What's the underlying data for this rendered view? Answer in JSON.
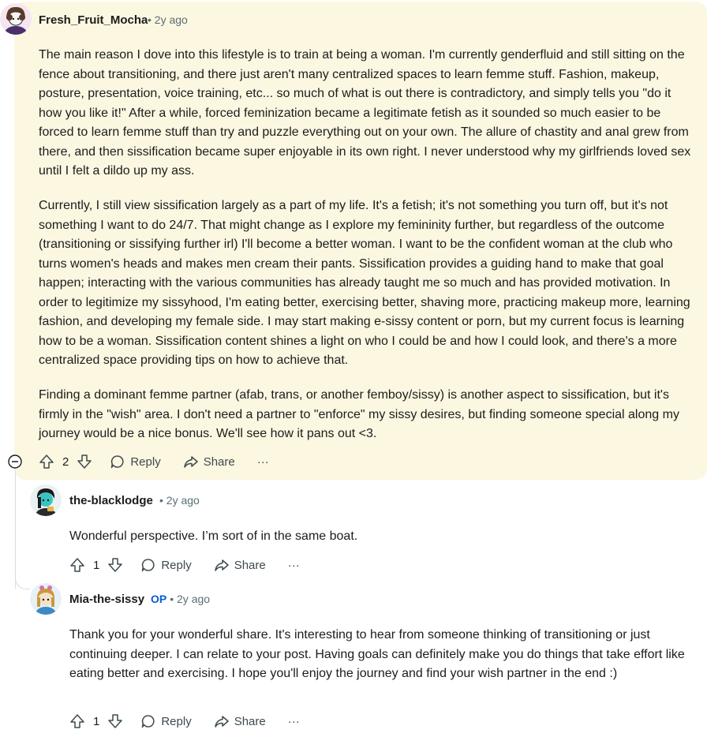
{
  "comments": [
    {
      "username": "Fresh_Fruit_Mocha",
      "time": "• 2y ago",
      "paragraphs": [
        "The main reason I dove into this lifestyle is to train at being a woman. I'm currently genderfluid and still sitting on the fence about transitioning, and there just aren't many centralized spaces to learn femme stuff. Fashion, makeup, posture, presentation, voice training, etc... so much of what is out there is contradictory, and simply tells you \"do it how you like it!\" After a while, forced feminization became a legitimate fetish as it sounded so much easier to be forced to learn femme stuff than try and puzzle everything out on your own. The allure of chastity and anal grew from there, and then sissification became super enjoyable in its own right. I never understood why my girlfriends loved sex until I felt a dildo up my ass.",
        "Currently, I still view sissification largely as a part of my life. It's a fetish; it's not something you turn off, but it's not something I want to do 24/7. That might change as I explore my femininity further, but regardless of the outcome (transitioning or sissifying further irl) I'll become a better woman. I want to be the confident woman at the club who turns women's heads and makes men cream their pants. Sissification provides a guiding hand to make that goal happen; interacting with the various communities has already taught me so much and has provided motivation. In order to legitimize my sissyhood, I'm eating better, exercising better, shaving more, practicing makeup more, learning fashion, and developing my female side. I may start making e-sissy content or porn, but my current focus is learning how to be a woman. Sissification content shines a light on who I could be and how I could look, and there's a more centralized space providing tips on how to achieve that.",
        "Finding a dominant femme partner (afab, trans, or another femboy/sissy) is another aspect to sissification, but it's firmly in the \"wish\" area. I don't need a partner to \"enforce\" my sissy desires, but finding someone special along my journey would be a nice bonus. We'll see how it pans out <3."
      ],
      "votes": "2",
      "reply_label": "Reply",
      "share_label": "Share",
      "more_label": "···"
    },
    {
      "username": "the-blacklodge",
      "time": "• 2y ago",
      "paragraphs": [
        "Wonderful perspective. I’m sort of in the same boat."
      ],
      "votes": "1",
      "reply_label": "Reply",
      "share_label": "Share",
      "more_label": "···"
    },
    {
      "username": "Mia-the-sissy",
      "op_badge": "OP",
      "time": "• 2y ago",
      "paragraphs": [
        "Thank you for your wonderful share. It's interesting to hear from someone thinking of transitioning or just continuing deeper. I can relate to your post. Having goals can definitely make you do things that take effort like eating better and exercising. I hope you'll enjoy the journey and find your wish partner in the end :)"
      ],
      "votes": "1",
      "reply_label": "Reply",
      "share_label": "Share",
      "more_label": "···"
    }
  ],
  "colors": {
    "highlight": "#fcf7e1",
    "op_badge": "#0a5ad9",
    "meta": "#576f76"
  }
}
